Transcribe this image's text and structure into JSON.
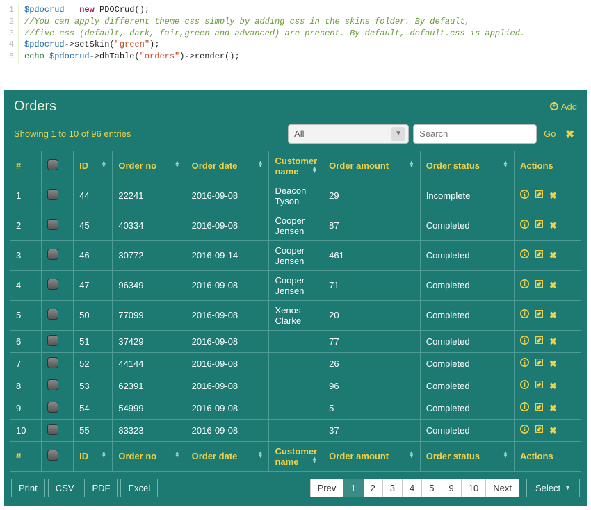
{
  "code": {
    "l1": {
      "var": "$pdocrud",
      "op": " = ",
      "new": "new",
      "sp": " ",
      "cls": "PDOCrud",
      "rest": "();"
    },
    "l2": "//You can apply different theme css simply by adding css in the skins folder. By default,",
    "l3": "//five css (default, dark, fair,green and advanced) are present. By default, default.css is applied.",
    "l4": {
      "var": "$pdocrud",
      "m1": "->setSkin(",
      "s1": "\"green\"",
      "m2": ");"
    },
    "l5": {
      "echo": "echo ",
      "var": "$pdocrud",
      "m1": "->dbTable(",
      "s1": "\"orders\"",
      "m2": ")->render();"
    }
  },
  "panel": {
    "title": "Orders",
    "add": "Add"
  },
  "showing": "Showing 1 to 10 of 96 entries",
  "filter": {
    "all": "All"
  },
  "search": {
    "placeholder": "Search",
    "go": "Go"
  },
  "cols": {
    "n": "#",
    "id": "ID",
    "no": "Order no",
    "date": "Order date",
    "cust": "Customer name",
    "amt": "Order amount",
    "stat": "Order status",
    "act": "Actions"
  },
  "rows": [
    {
      "n": "1",
      "id": "44",
      "no": "22241",
      "date": "2016-09-08",
      "cust": "Deacon Tyson",
      "amt": "29",
      "stat": "Incomplete"
    },
    {
      "n": "2",
      "id": "45",
      "no": "40334",
      "date": "2016-09-08",
      "cust": "Cooper Jensen",
      "amt": "87",
      "stat": "Completed"
    },
    {
      "n": "3",
      "id": "46",
      "no": "30772",
      "date": "2016-09-14",
      "cust": "Cooper Jensen",
      "amt": "461",
      "stat": "Completed"
    },
    {
      "n": "4",
      "id": "47",
      "no": "96349",
      "date": "2016-09-08",
      "cust": "Cooper Jensen",
      "amt": "71",
      "stat": "Completed"
    },
    {
      "n": "5",
      "id": "50",
      "no": "77099",
      "date": "2016-09-08",
      "cust": "Xenos Clarke",
      "amt": "20",
      "stat": "Completed"
    },
    {
      "n": "6",
      "id": "51",
      "no": "37429",
      "date": "2016-09-08",
      "cust": "",
      "amt": "77",
      "stat": "Completed"
    },
    {
      "n": "7",
      "id": "52",
      "no": "44144",
      "date": "2016-09-08",
      "cust": "",
      "amt": "26",
      "stat": "Completed"
    },
    {
      "n": "8",
      "id": "53",
      "no": "62391",
      "date": "2016-09-08",
      "cust": "",
      "amt": "96",
      "stat": "Completed"
    },
    {
      "n": "9",
      "id": "54",
      "no": "54999",
      "date": "2016-09-08",
      "cust": "",
      "amt": "5",
      "stat": "Completed"
    },
    {
      "n": "10",
      "id": "55",
      "no": "83323",
      "date": "2016-09-08",
      "cust": "",
      "amt": "37",
      "stat": "Completed"
    }
  ],
  "export": {
    "print": "Print",
    "csv": "CSV",
    "pdf": "PDF",
    "excel": "Excel"
  },
  "pager": {
    "prev": "Prev",
    "next": "Next",
    "pages": [
      "1",
      "2",
      "3",
      "4",
      "5",
      "9",
      "10"
    ]
  },
  "select": "Select"
}
